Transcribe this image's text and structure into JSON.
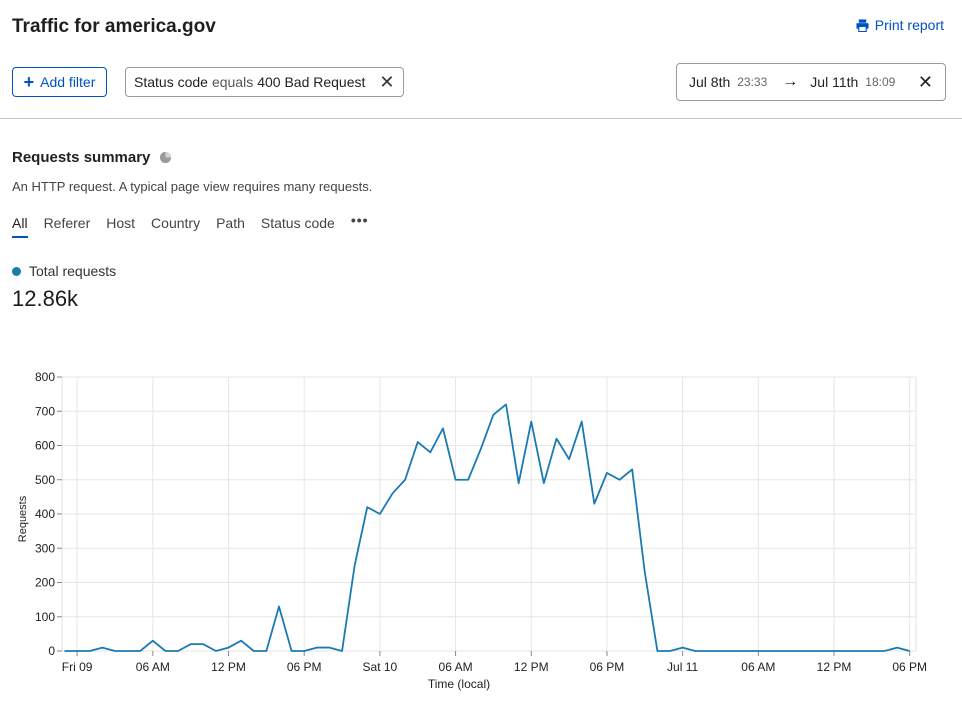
{
  "header": {
    "title": "Traffic for america.gov",
    "print_label": "Print report"
  },
  "filters": {
    "add_label": "Add filter",
    "chip": {
      "field": "Status code",
      "operator": "equals",
      "value": "400 Bad Request"
    }
  },
  "date_range": {
    "start_date": "Jul 8th",
    "start_time": "23:33",
    "arrow": "→",
    "end_date": "Jul 11th",
    "end_time": "18:09"
  },
  "summary": {
    "title": "Requests summary",
    "description": "An HTTP request. A typical page view requires many requests.",
    "tabs": [
      "All",
      "Referer",
      "Host",
      "Country",
      "Path",
      "Status code"
    ],
    "active_tab": "All",
    "legend_label": "Total requests",
    "total_value": "12.86k"
  },
  "colors": {
    "accent": "#0051c3",
    "series": "#1a7ab4"
  },
  "chart_data": {
    "type": "line",
    "xlabel": "Time (local)",
    "ylabel": "Requests",
    "ylim": [
      0,
      800
    ],
    "yticks": [
      0,
      100,
      200,
      300,
      400,
      500,
      600,
      700,
      800
    ],
    "xlim": [
      -1.2,
      66.5
    ],
    "xticks": [
      {
        "label": "Fri 09",
        "x": 0
      },
      {
        "label": "06 AM",
        "x": 6
      },
      {
        "label": "12 PM",
        "x": 12
      },
      {
        "label": "06 PM",
        "x": 18
      },
      {
        "label": "Sat 10",
        "x": 24
      },
      {
        "label": "06 AM",
        "x": 30
      },
      {
        "label": "12 PM",
        "x": 36
      },
      {
        "label": "06 PM",
        "x": 42
      },
      {
        "label": "Jul 11",
        "x": 48
      },
      {
        "label": "06 AM",
        "x": 54
      },
      {
        "label": "12 PM",
        "x": 60
      },
      {
        "label": "06 PM",
        "x": 66
      }
    ],
    "grid": true,
    "series": [
      {
        "x": [
          -1,
          0,
          1,
          2,
          3,
          4,
          5,
          6,
          7,
          8,
          9,
          10,
          11,
          12,
          13,
          14,
          15,
          16,
          17,
          18,
          19,
          20,
          21,
          22,
          23,
          24,
          25,
          26,
          27,
          28,
          29,
          30,
          31,
          32,
          33,
          34,
          35,
          36,
          37,
          38,
          39,
          40,
          41,
          42,
          43,
          44,
          45,
          46,
          47,
          48,
          49,
          50,
          51,
          52,
          53,
          54,
          55,
          56,
          57,
          58,
          59,
          60,
          61,
          62,
          63,
          64,
          65,
          66
        ],
        "values": [
          0,
          0,
          0,
          10,
          0,
          0,
          0,
          30,
          0,
          0,
          20,
          20,
          0,
          10,
          30,
          0,
          0,
          130,
          0,
          0,
          10,
          10,
          0,
          250,
          420,
          400,
          460,
          500,
          610,
          580,
          650,
          500,
          500,
          590,
          690,
          720,
          490,
          670,
          490,
          620,
          560,
          670,
          430,
          520,
          500,
          530,
          230,
          0,
          0,
          10,
          0,
          0,
          0,
          0,
          0,
          0,
          0,
          0,
          0,
          0,
          0,
          0,
          0,
          0,
          0,
          0,
          10,
          0
        ]
      }
    ]
  }
}
